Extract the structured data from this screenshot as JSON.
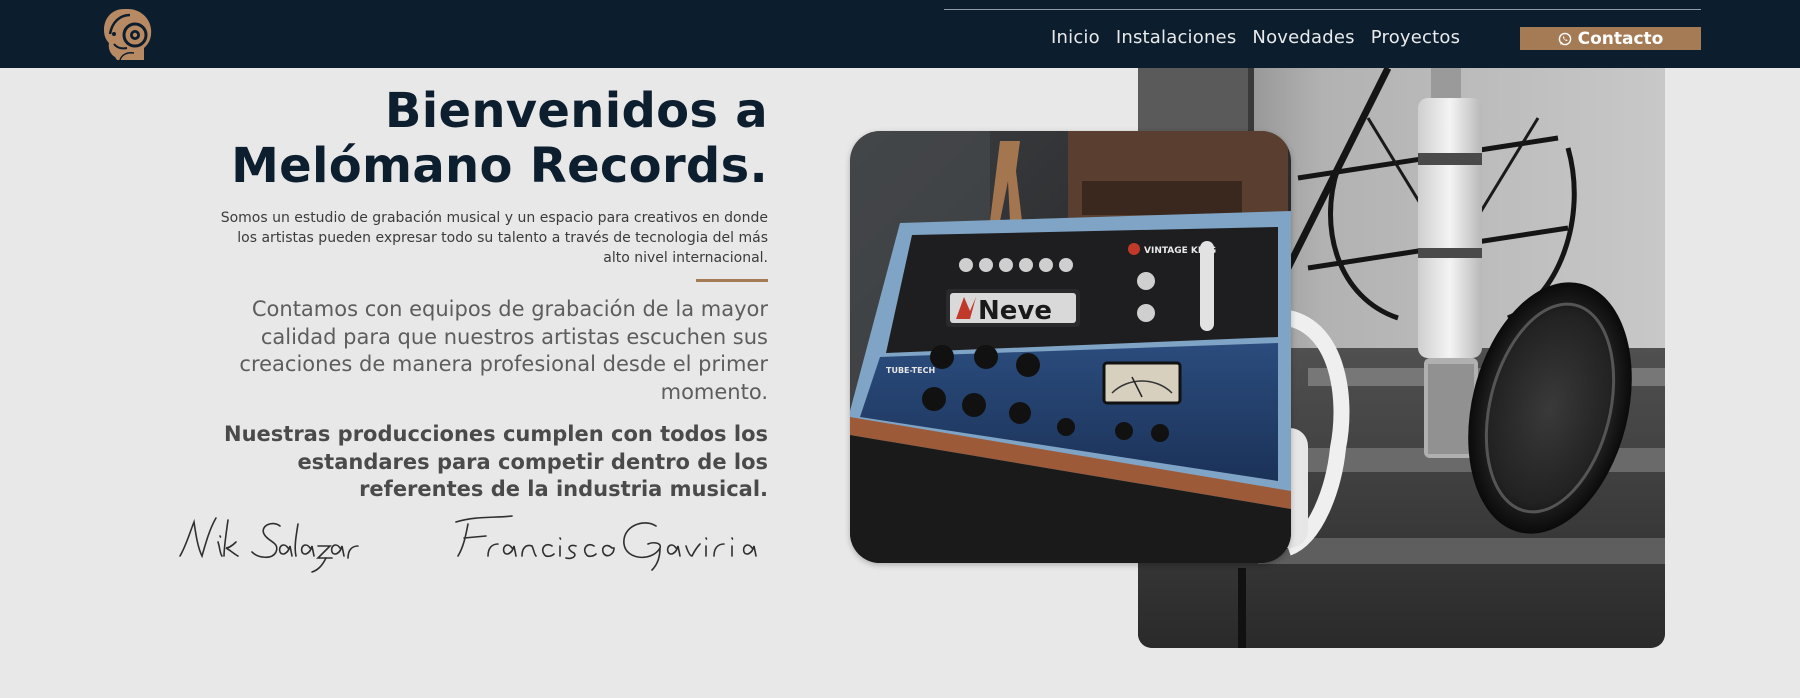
{
  "nav": {
    "items": [
      {
        "label": "Inicio"
      },
      {
        "label": "Instalaciones"
      },
      {
        "label": "Novedades"
      },
      {
        "label": "Proyectos"
      }
    ],
    "contact_label": "Contacto",
    "contact_icon": "whatsapp-icon"
  },
  "hero": {
    "title_line1": "Bienvenidos a",
    "title_line2": "Melómano Records.",
    "intro": "Somos un estudio de grabación musical y un espacio para creativos en donde los artistas pueden expresar todo su talento a través de tecnologia del más alto nivel internacional.",
    "paragraph1": "Contamos con equipos de grabación de la mayor calidad para que nuestros artistas escuchen sus creaciones de manera profesional desde el primer momento.",
    "paragraph2": "Nuestras producciones cumplen con todos los estandares para competir dentro de los referentes de la industria musical.",
    "signature1": "Nik Salazar",
    "signature2": "Francisco Gaviria"
  },
  "photos": {
    "console_brand": "Neve",
    "console_unit": "VINTAGE KING",
    "console_unit2": "TUBE-TECH"
  },
  "colors": {
    "header_bg": "#0c1d2d",
    "accent": "#a57b55",
    "page_bg": "#e8e8e8",
    "title": "#0d1e2f"
  }
}
